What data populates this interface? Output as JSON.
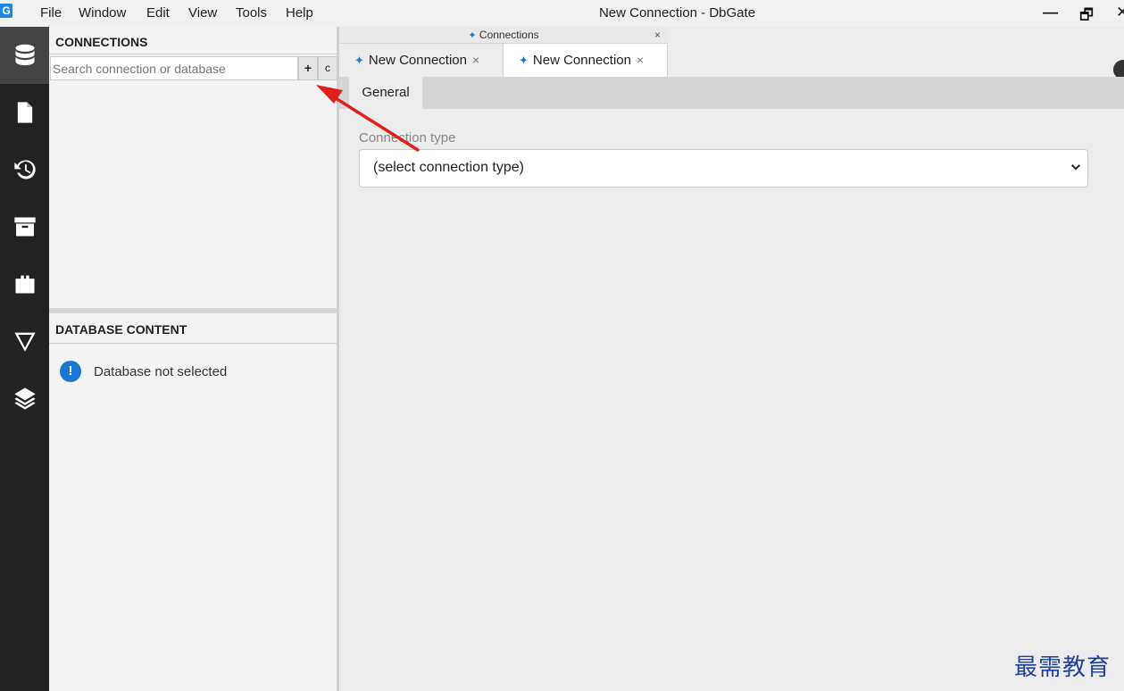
{
  "titlebar": {
    "logo_letter": "G",
    "menu": [
      "File",
      "Window",
      "Edit",
      "View",
      "Tools",
      "Help"
    ],
    "window_title": "New Connection - DbGate",
    "minimize_label": "—",
    "restore_label": "🗗",
    "close_label": "✕"
  },
  "activity_bar": {
    "items": [
      "database-icon",
      "file-icon",
      "history-icon",
      "archive-icon",
      "plugin-icon",
      "filter-icon",
      "layers-icon"
    ],
    "active_index": 0
  },
  "connections": {
    "header": "CONNECTIONS",
    "search_placeholder": "Search connection or database",
    "add_label": "+",
    "refresh_label": "c"
  },
  "database_content": {
    "header": "DATABASE CONTENT",
    "empty_message": "Database not selected",
    "info_glyph": "!"
  },
  "tabs": {
    "group_caption": "Connections",
    "group_close": "×",
    "items": [
      {
        "label": "New Connection",
        "close": "×",
        "active": false
      },
      {
        "label": "New Connection",
        "close": "×",
        "active": true
      }
    ]
  },
  "form": {
    "subtab": "General",
    "conntype_label": "Connection type",
    "conntype_value": "(select connection type)"
  },
  "colors": {
    "accent": "#1976d2",
    "activity_bg": "#222222",
    "annotation_arrow": "#e0201c"
  },
  "watermark": "最需教育"
}
